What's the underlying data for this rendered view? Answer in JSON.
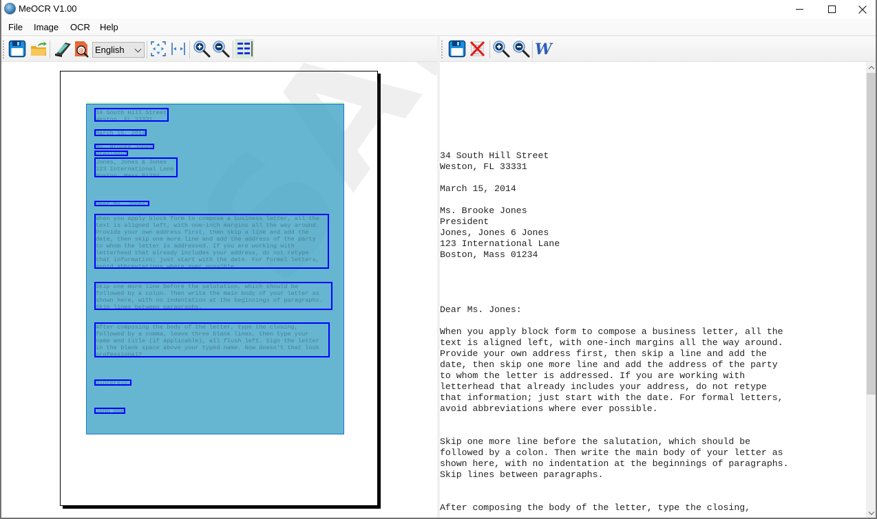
{
  "window": {
    "title": "MeOCR V1.00",
    "icon": "app-globe-icon",
    "controls": [
      "minimize",
      "maximize",
      "close"
    ]
  },
  "menu": {
    "items": [
      {
        "label": "File"
      },
      {
        "label": "Image"
      },
      {
        "label": "OCR"
      },
      {
        "label": "Help"
      }
    ]
  },
  "left_toolbar": {
    "buttons": [
      {
        "name": "save",
        "icon": "floppy-disk-icon"
      },
      {
        "name": "open",
        "icon": "open-folder-icon"
      },
      {
        "name": "scan",
        "icon": "scanner-icon"
      },
      {
        "name": "ocr-recognize",
        "icon": "ocr-search-icon"
      },
      {
        "name": "fit-page",
        "icon": "fit-page-icon"
      },
      {
        "name": "fit-width",
        "icon": "fit-width-icon"
      },
      {
        "name": "zoom-in",
        "icon": "zoom-in-icon"
      },
      {
        "name": "zoom-out",
        "icon": "zoom-out-icon"
      },
      {
        "name": "layout-blocks",
        "icon": "layout-blocks-icon"
      }
    ],
    "language": {
      "selected": "English"
    }
  },
  "right_toolbar": {
    "buttons": [
      {
        "name": "save-text",
        "icon": "floppy-disk-icon"
      },
      {
        "name": "clear-text",
        "icon": "clear-document-icon"
      },
      {
        "name": "zoom-in",
        "icon": "zoom-in-icon"
      },
      {
        "name": "zoom-out",
        "icon": "zoom-out-icon"
      },
      {
        "name": "export-word",
        "icon": "word-icon"
      }
    ]
  },
  "image_view": {
    "watermark": "SAMPLE",
    "accent_region_color": "#3ba0c4",
    "box_color": "#0000ff",
    "blocks": [
      {
        "text": "34 South Hill Street\nWeston, FL 33331"
      },
      {
        "text": "March 15, 2014"
      },
      {
        "text": "Ms. Brooke Jones"
      },
      {
        "text": "President"
      },
      {
        "text": "Jones, Jones & Jones\n123 International Lane\nBoston, Mass 01234"
      },
      {
        "text": "Dear Ms. Jones:"
      },
      {
        "text": "When you apply block form to compose a business letter, all the\ntext is aligned left, with one-inch margins all the way around.\nProvide your own address first, then skip a line and add the\ndate, then skip one more line and add the address of the party\nto whom the letter is addressed. If you are working with\nletterhead that already includes your address, do not retype\nthat information; just start with the date. For formal letters,\navoid abbreviations where ever possible."
      },
      {
        "text": "Skip one more line before the salutation, which should be\nfollowed by a colon. Then write the main body of your letter as\nshown here, with no indentation at the beginnings of paragraphs.\nSkip lines between paragraphs."
      },
      {
        "text": "After composing the body of the letter, type the closing,\nfollowed by a comma, leave three blank lines, then type your\nname and title (if applicable), all flush left. Sign the letter\nin the blank space above your typed name. Now doesn't that look\nprofessional?"
      },
      {
        "text": "Sincerely,"
      },
      {
        "text": "John Doe"
      }
    ]
  },
  "text_view": {
    "lines": [
      "34 South Hill Street",
      "Weston, FL 33331",
      "",
      "March 15, 2014",
      "",
      "Ms. Brooke Jones",
      "President",
      "Jones, Jones 6 Jones",
      "123 International Lane",
      "Boston, Mass 01234",
      "",
      "",
      "",
      "",
      "Dear Ms. Jones:",
      "",
      "When you apply block form to compose a business letter, all the",
      "text is aligned left, with one-inch margins all the way around.",
      "Provide your own address first, then skip a line and add the",
      "date, then skip one more line and add the address of the party",
      "to whom the letter is addressed. If you are working with",
      "letterhead that already includes your address, do not retype",
      "that information; just start with the date. For formal letters,",
      "avoid abbreviations where ever possible.",
      "",
      "",
      "Skip one more line before the salutation, which should be",
      "followed by a colon. Then write the main body of your letter as",
      "shown here, with no indentation at the beginnings of paragraphs.",
      "Skip lines between paragraphs.",
      "",
      "",
      "After composing the body of the letter, type the closing,"
    ],
    "scroll_position_fraction": 0.0,
    "visible_fraction": 0.74
  }
}
